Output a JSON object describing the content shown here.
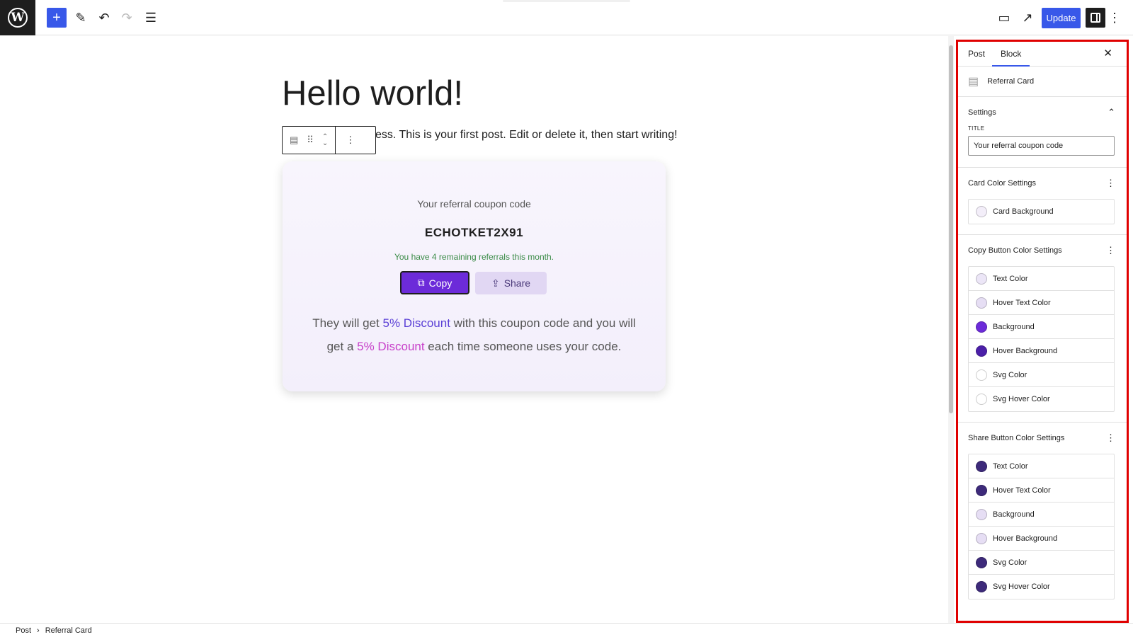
{
  "topbar": {
    "update_label": "Update",
    "icons": [
      "wordpress-logo",
      "add-block-icon",
      "edit-tool-icon",
      "undo-icon",
      "redo-icon",
      "document-overview-icon",
      "view-icon",
      "external-preview-icon",
      "settings-sidebar-icon",
      "options-icon"
    ]
  },
  "editor": {
    "title": "Hello world!",
    "paragraph": "ess. This is your first post. Edit or delete it, then start writing!"
  },
  "card": {
    "title": "Your referral coupon code",
    "code": "ECHOTKET2X91",
    "remaining": "You have 4 remaining referrals this month.",
    "copy_label": "Copy",
    "share_label": "Share",
    "desc_part1": "They will get ",
    "desc_highlight1": "5% Discount",
    "desc_part2": " with this coupon code and you will get a ",
    "desc_highlight2": "5% Discount",
    "desc_part3": " each time someone uses your code.",
    "colors": {
      "background": "#f5f1fc",
      "copy_bg": "#6c2bd9",
      "share_bg": "#e1d7f3",
      "remaining_text": "#3a8b46",
      "highlight1": "#5a3fd6",
      "highlight2": "#c73fc9"
    }
  },
  "sidebar": {
    "tabs": [
      "Post",
      "Block"
    ],
    "active_tab": "Block",
    "block_name": "Referral Card",
    "settings": {
      "heading": "Settings",
      "title_label": "TITLE",
      "title_value": "Your referral coupon code"
    },
    "card_color": {
      "heading": "Card Color Settings",
      "items": [
        {
          "label": "Card Background",
          "color": "#f3eef9"
        }
      ]
    },
    "copy_button_color": {
      "heading": "Copy Button Color Settings",
      "items": [
        {
          "label": "Text Color",
          "color": "#ece6f7"
        },
        {
          "label": "Hover Text Color",
          "color": "#e6def4"
        },
        {
          "label": "Background",
          "color": "#6c2bd9"
        },
        {
          "label": "Hover Background",
          "color": "#4b1fa8"
        },
        {
          "label": "Svg Color",
          "color": "#ffffff"
        },
        {
          "label": "Svg Hover Color",
          "color": "#ffffff"
        }
      ]
    },
    "share_button_color": {
      "heading": "Share Button Color Settings",
      "items": [
        {
          "label": "Text Color",
          "color": "#3d2a7a"
        },
        {
          "label": "Hover Text Color",
          "color": "#3d2a7a"
        },
        {
          "label": "Background",
          "color": "#e6def4"
        },
        {
          "label": "Hover Background",
          "color": "#e6def4"
        },
        {
          "label": "Svg Color",
          "color": "#3d2a7a"
        },
        {
          "label": "Svg Hover Color",
          "color": "#3d2a7a"
        }
      ]
    }
  },
  "footer": {
    "crumb1": "Post",
    "crumb2": "Referral Card"
  }
}
